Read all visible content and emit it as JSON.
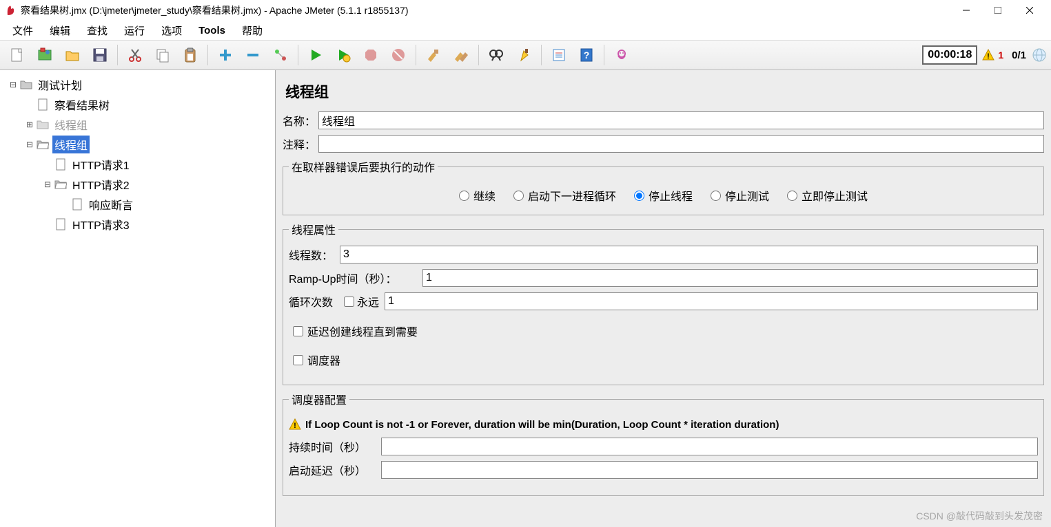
{
  "window": {
    "title": "察看结果树.jmx (D:\\jmeter\\jmeter_study\\察看结果树.jmx) - Apache JMeter (5.1.1 r1855137)"
  },
  "menu": {
    "file": "文件",
    "edit": "编辑",
    "search": "查找",
    "run": "运行",
    "options": "选项",
    "tools": "Tools",
    "help": "帮助"
  },
  "toolbar": {
    "new": "new-icon",
    "templates": "templates-icon",
    "open": "open-icon",
    "save": "save-icon",
    "cut": "cut-icon",
    "copy": "copy-icon",
    "paste": "paste-icon",
    "expand": "expand-icon",
    "collapse": "collapse-icon",
    "toggle": "toggle-icon",
    "start": "start-icon",
    "start_no_timers": "start-no-timers-icon",
    "stop": "stop-icon",
    "shutdown": "shutdown-icon",
    "clear": "clear-icon",
    "clear_all": "clear-all-icon",
    "find": "search-binoculars-icon",
    "reset": "reset-search-icon",
    "fn": "function-helper-icon",
    "help": "help-icon",
    "plugin": "plugin-icon",
    "timer": "00:00:18",
    "warn_count": "1",
    "thread_count": "0/1"
  },
  "tree": {
    "root": "测试计划",
    "n1": "察看结果树",
    "n2": "线程组",
    "n3": "线程组",
    "n3_1": "HTTP请求1",
    "n3_2": "HTTP请求2",
    "n3_2_1": "响应断言",
    "n3_3": "HTTP请求3"
  },
  "form": {
    "panel_title": "线程组",
    "name_label": "名称：",
    "name_value": "线程组",
    "comments_label": "注释：",
    "comments_value": "",
    "error_action_legend": "在取样器错误后要执行的动作",
    "radio_continue": "继续",
    "radio_start_next": "启动下一进程循环",
    "radio_stop_thread": "停止线程",
    "radio_stop_test": "停止测试",
    "radio_stop_now": "立即停止测试",
    "thread_props_legend": "线程属性",
    "threads_label": "线程数：",
    "threads_value": "3",
    "rampup_label": "Ramp-Up时间（秒）：",
    "rampup_value": "1",
    "loop_label": "循环次数",
    "loop_forever": "永远",
    "loop_value": "1",
    "delay_create": "延迟创建线程直到需要",
    "scheduler": "调度器",
    "scheduler_legend": "调度器配置",
    "scheduler_warning": "If Loop Count is not -1 or Forever, duration will be min(Duration, Loop Count * iteration duration)",
    "duration_label": "持续时间（秒）",
    "duration_value": "",
    "delay_label": "启动延迟（秒）",
    "delay_value": ""
  },
  "watermark": "CSDN @敲代码敲到头发茂密"
}
